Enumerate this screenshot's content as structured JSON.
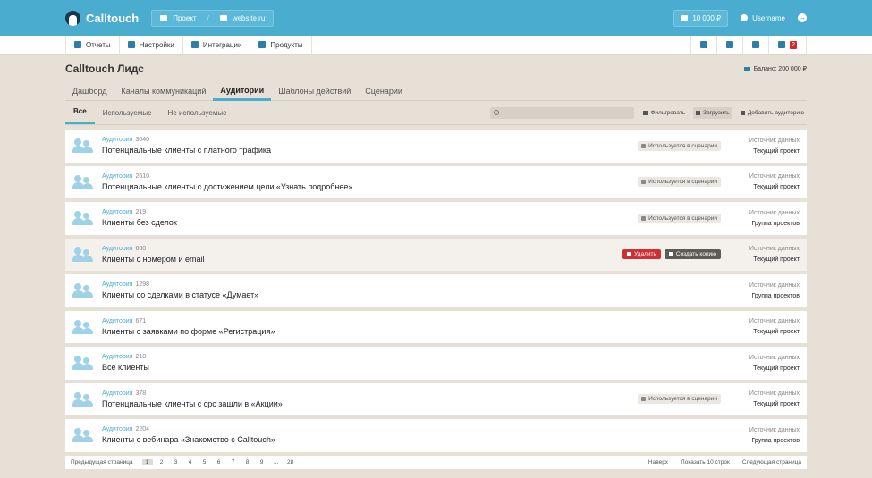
{
  "topbar": {
    "brand": "Calltouch",
    "project_label": "Проект",
    "site_label": "website.ru",
    "balance": "10 000 ₽",
    "username": "Username"
  },
  "menu": {
    "items": [
      "Отчеты",
      "Настройки",
      "Интеграции",
      "Продукты"
    ],
    "notifications_count": "2"
  },
  "page": {
    "title": "Calltouch Лидс",
    "balance_text": "Баланс: 200 000 ₽"
  },
  "tabs": [
    "Дашборд",
    "Каналы коммуникаций",
    "Аудитории",
    "Шаблоны действий",
    "Сценарии"
  ],
  "filters": {
    "tabs": [
      "Все",
      "Используемые",
      "Не используемые"
    ],
    "search_placeholder": "",
    "filter_label": "Фильтровать",
    "upload_label": "Загрузить",
    "add_label": "Добавить аудиторию"
  },
  "labels": {
    "audience": "Аудитория",
    "used_in_scenario": "Используется в сценарии",
    "data_source": "Источник данных",
    "delete": "Удалить",
    "copy": "Создать копию"
  },
  "audiences": [
    {
      "count": "3040",
      "name": "Потенциальные клиенты с платного трафика",
      "used": true,
      "source": "Текущий проект"
    },
    {
      "count": "2610",
      "name": "Потенциальные клиенты с достижением цели «Узнать подробнее»",
      "used": true,
      "source": "Текущий проект"
    },
    {
      "count": "219",
      "name": "Клиенты без сделок",
      "used": true,
      "source": "Группа проектов"
    },
    {
      "count": "660",
      "name": "Клиенты с номером и email",
      "used": false,
      "hover": true,
      "source": "Текущий проект"
    },
    {
      "count": "1298",
      "name": "Клиенты со сделками в статусе «Думает»",
      "used": false,
      "source": "Группа проектов"
    },
    {
      "count": "671",
      "name": "Клиенты с заявками по форме «Регистрация»",
      "used": false,
      "source": "Текущий проект"
    },
    {
      "count": "218",
      "name": "Все клиенты",
      "used": false,
      "source": "Текущий проект"
    },
    {
      "count": "378",
      "name": "Потенциальные клиенты с cpc зашли в «Акции»",
      "used": true,
      "source": "Текущий проект"
    },
    {
      "count": "2204",
      "name": "Клиенты с вебинара «Знакомство с Calltouch»",
      "used": false,
      "source": "Группа проектов"
    }
  ],
  "pagination": {
    "prev": "Предыдущая страница",
    "pages": [
      "1",
      "2",
      "3",
      "4",
      "5",
      "6",
      "7",
      "8",
      "9",
      "...",
      "28"
    ],
    "up": "Наверх",
    "show": "Показать 10 строк",
    "next": "Следующая страница"
  },
  "colors": {
    "accent": "#4aaccf",
    "danger": "#d02f35",
    "background": "#e6e0d6"
  }
}
